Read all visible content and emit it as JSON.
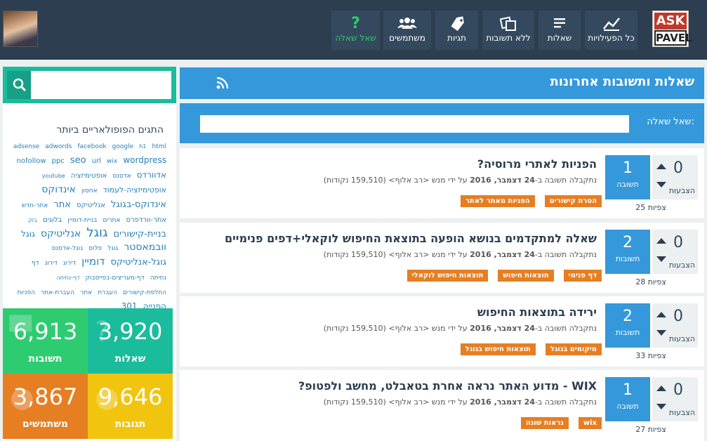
{
  "logo": {
    "line1": "ASK",
    "line2": "PAVEL"
  },
  "nav": [
    {
      "label": "כל הפעילויות",
      "icon": "activity-icon"
    },
    {
      "label": "שאלות",
      "icon": "list-icon"
    },
    {
      "label": "ללא תשובות",
      "icon": "unanswered-icon"
    },
    {
      "label": "תגיות",
      "icon": "tag-icon"
    },
    {
      "label": "משתמשים",
      "icon": "users-icon"
    },
    {
      "label": "שאל שאלה",
      "icon": "question-icon"
    }
  ],
  "main": {
    "title": "שאלות ותשובות אחרונות",
    "ask_label": "שאל שאלה:"
  },
  "questions": [
    {
      "title": "הפניות לאתרי מרוסיה?",
      "votes": "0",
      "votes_label": "הצבעות",
      "answers": "1",
      "answers_label": "תשובה",
      "views": "25 צפיות",
      "meta_pre": "נתקבלה תשובה ב-",
      "meta_date": "24 דצמבר, 2016",
      "meta_post": "על ידי מנש <רב אלוף> (159,510 נקודות)",
      "tags": [
        "הסרת קישורים",
        "הפניות מאתר לאתר"
      ]
    },
    {
      "title": "שאלה למתקדמים בנושא הופעה בתוצאת החיפוש לוקאלי+דפים פנימיים",
      "votes": "0",
      "votes_label": "הצבעות",
      "answers": "2",
      "answers_label": "תשובות",
      "views": "28 צפיות",
      "meta_pre": "נתקבלה תשובה ב-",
      "meta_date": "24 דצמבר, 2016",
      "meta_post": "על ידי מנש <רב אלוף> (159,510 נקודות)",
      "tags": [
        "דף פנימי",
        "תוצאות חיפוש",
        "תוצאות חיפוש לוקאלי"
      ]
    },
    {
      "title": "ירידה בתוצאות החיפוש",
      "votes": "0",
      "votes_label": "הצבעות",
      "answers": "2",
      "answers_label": "תשובות",
      "views": "33 צפיות",
      "meta_pre": "נתקבלה תשובה ב-",
      "meta_date": "24 דצמבר, 2016",
      "meta_post": "על ידי מנש <רב אלוף> (159,510 נקודות)",
      "tags": [
        "מיקומים בגוגל",
        "תוצאות חיפוש בגוגל"
      ]
    },
    {
      "title": "WIX - מדוע האתר נראה אחרת בטאבלט, מחשב ולפטופ?",
      "votes": "0",
      "votes_label": "הצבעות",
      "answers": "1",
      "answers_label": "תשובה",
      "views": "27 צפיות",
      "meta_pre": "נתקבלה תשובה ב-",
      "meta_date": "24 דצמבר, 2016",
      "meta_post": "על ידי מנש <רב אלוף> (159,510 נקודות)",
      "tags": [
        "wix",
        "נראות שונה"
      ]
    }
  ],
  "sidebar": {
    "tags_title": "התגים הפופולאריים ביותר",
    "cloud": [
      [
        "adsense",
        "9"
      ],
      [
        "adwords",
        "9"
      ],
      [
        "facebook",
        "9"
      ],
      [
        "google",
        "9"
      ],
      [
        "h1",
        "8"
      ],
      [
        "html",
        "9"
      ],
      [
        "nofollow",
        "10"
      ],
      [
        "ppc",
        "10"
      ],
      [
        "seo",
        "13"
      ],
      [
        "url",
        "10"
      ],
      [
        "wix",
        "9"
      ],
      [
        "wordpress",
        "12"
      ],
      [
        "אדוורדס",
        "12"
      ],
      [
        "אדסנס",
        "9"
      ],
      [
        "אופטימיזציה",
        "10"
      ],
      [
        "youtube",
        "8"
      ],
      [
        "אופטימיזציה-לעמוד",
        "11"
      ],
      [
        "אחסון",
        "9"
      ],
      [
        "אינדוקס",
        "14"
      ],
      [
        "אינדוקס-בגוגל",
        "13"
      ],
      [
        "אנליטיקס",
        "10"
      ],
      [
        "אתר",
        "13"
      ],
      [
        "אתר-חדש",
        "9"
      ],
      [
        "אתר-וורדפרס",
        "10"
      ],
      [
        "אתרים",
        "9"
      ],
      [
        "בניית-דומיין",
        "9"
      ],
      [
        "בלוגים",
        "10"
      ],
      [
        "בזק",
        "8"
      ],
      [
        "בניית-קישורים",
        "13"
      ],
      [
        "גוגל",
        "18"
      ],
      [
        "אנליטיקס",
        "14"
      ],
      [
        "גוגל",
        "12"
      ],
      [
        "וובמאסטר",
        "14"
      ],
      [
        "גוגל",
        "9"
      ],
      [
        "פלוס",
        "9"
      ],
      [
        "גוגל-אדסנס",
        "9"
      ],
      [
        "גוגל-אנליטיקס",
        "13"
      ],
      [
        "דומיין",
        "15"
      ],
      [
        "דירוג",
        "9"
      ],
      [
        "דירוג",
        "9"
      ],
      [
        "דף",
        "9"
      ],
      [
        "נחיתה",
        "9"
      ],
      [
        "דף-מעריצים-בפייסבוק",
        "9"
      ],
      [
        "דף-נחיתה",
        "8"
      ],
      [
        "החלפת-קישורים",
        "9"
      ],
      [
        "העברת",
        "9"
      ],
      [
        "אתר",
        "9"
      ],
      [
        "העברת-אתר",
        "9"
      ],
      [
        "הפניות",
        "9"
      ],
      [
        "הפנייה",
        "12"
      ],
      [
        "301",
        "12"
      ]
    ],
    "stats": [
      {
        "num": "3,920",
        "label": "שאלות",
        "color": "#1abc9c",
        "icon": "question-icon"
      },
      {
        "num": "6,913",
        "label": "תשובות",
        "color": "#2ecc71",
        "icon": "answer-icon"
      },
      {
        "num": "9,646",
        "label": "תגובות",
        "color": "#f1c40f",
        "icon": "comment-icon"
      },
      {
        "num": "3,867",
        "label": "משתמשים",
        "color": "#e67e22",
        "icon": "users-icon"
      }
    ]
  }
}
